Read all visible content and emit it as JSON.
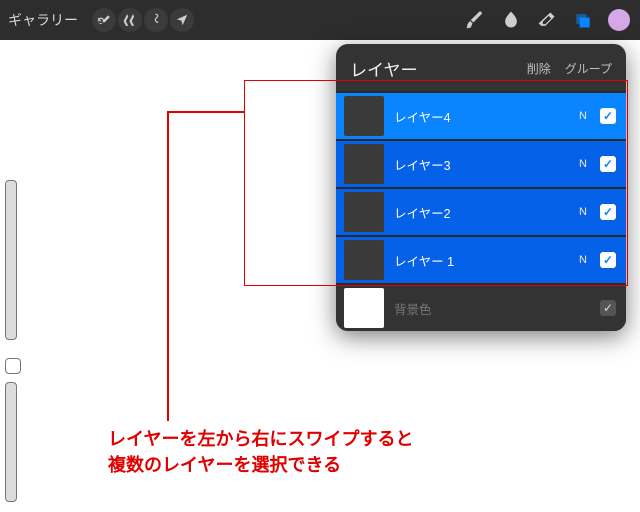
{
  "topbar": {
    "gallery": "ギャラリー",
    "left_tools": [
      "wrench",
      "wand",
      "s-italic",
      "arrow"
    ],
    "right_tools": [
      "brush",
      "smudge",
      "eraser",
      "layers",
      "color"
    ]
  },
  "panel": {
    "title": "レイヤー",
    "action_delete": "削除",
    "action_group": "グループ",
    "layers": [
      {
        "name": "レイヤー4",
        "blend": "N",
        "checked": true,
        "state": "primary"
      },
      {
        "name": "レイヤー3",
        "blend": "N",
        "checked": true,
        "state": "selected"
      },
      {
        "name": "レイヤー2",
        "blend": "N",
        "checked": true,
        "state": "selected"
      },
      {
        "name": "レイヤー 1",
        "blend": "N",
        "checked": true,
        "state": "selected"
      }
    ],
    "background_label": "背景色"
  },
  "annotation": {
    "line1": "レイヤーを左から右にスワイプすると",
    "line2": "複数のレイヤーを選択できる"
  },
  "colors": {
    "accent": "#0a84ff",
    "annot": "#e00000",
    "swatch": "#d5a8e6"
  }
}
